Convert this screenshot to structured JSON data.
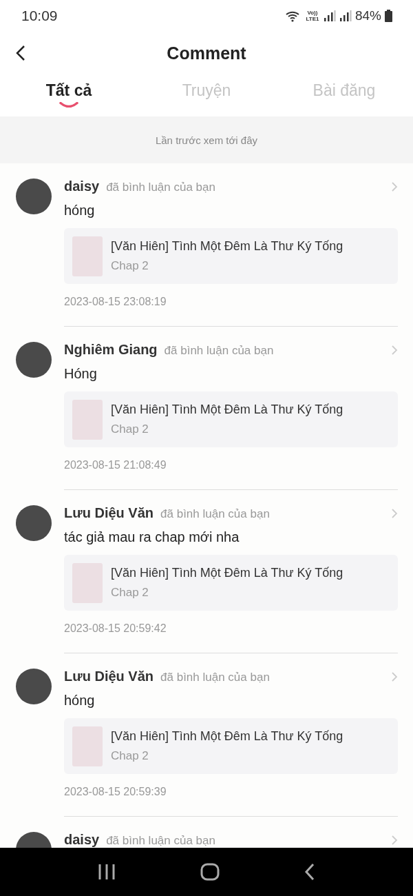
{
  "status_bar": {
    "time": "10:09",
    "network_label": "Vo)) LTE1",
    "battery": "84%"
  },
  "header": {
    "title": "Comment"
  },
  "tabs": [
    {
      "label": "Tất cả",
      "selected": true
    },
    {
      "label": "Truyện",
      "selected": false
    },
    {
      "label": "Bài đăng",
      "selected": false
    }
  ],
  "banner": "Lần trước xem tới đây",
  "comments": [
    {
      "user": "daisy",
      "action": "đã bình luận của bạn",
      "text": "hóng",
      "story": "[Văn Hiên] Tình Một Đêm Là Thư Ký Tống",
      "chapter": "Chap 2",
      "time": "2023-08-15 23:08:19"
    },
    {
      "user": "Nghiêm Giang",
      "action": "đã bình luận của bạn",
      "text": "Hóng",
      "story": "[Văn Hiên] Tình Một Đêm Là Thư Ký Tống",
      "chapter": "Chap 2",
      "time": "2023-08-15 21:08:49"
    },
    {
      "user": "Lưu Diệu Văn",
      "action": "đã bình luận của bạn",
      "text": "tác giả mau ra chap mới nha",
      "story": "[Văn Hiên] Tình Một Đêm Là Thư Ký Tống",
      "chapter": "Chap 2",
      "time": "2023-08-15 20:59:42"
    },
    {
      "user": "Lưu Diệu Văn",
      "action": "đã bình luận của bạn",
      "text": "hóng",
      "story": "[Văn Hiên] Tình Một Đêm Là Thư Ký Tống",
      "chapter": "Chap 2",
      "time": "2023-08-15 20:59:39"
    },
    {
      "user": "daisy",
      "action": "đã bình luận của bạn"
    }
  ]
}
